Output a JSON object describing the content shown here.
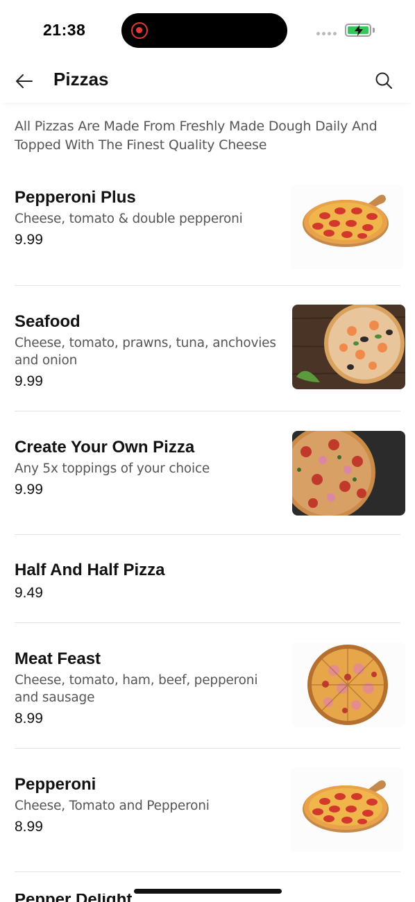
{
  "status": {
    "time": "21:38"
  },
  "header": {
    "title": "Pizzas"
  },
  "intro": "All Pizzas Are Made From Freshly Made Dough Daily And Topped With The Finest Quality Cheese",
  "items": [
    {
      "name": "Pepperoni Plus",
      "description": "Cheese, tomato & double pepperoni",
      "price": "9.99",
      "image": "pepperoni-pizza-on-board"
    },
    {
      "name": "Seafood",
      "description": "Cheese, tomato, prawns, tuna, anchovies and onion",
      "price": "9.99",
      "image": "seafood-pizza-on-wood"
    },
    {
      "name": "Create Your Own Pizza",
      "description": "Any 5x toppings of your choice",
      "price": "9.99",
      "image": "mixed-topping-pizza-on-dark"
    },
    {
      "name": "Half And Half Pizza",
      "description": "",
      "price": "9.49",
      "image": ""
    },
    {
      "name": "Meat Feast",
      "description": "Cheese, tomato, ham, beef, pepperoni and sausage",
      "price": "8.99",
      "image": "meat-feast-pizza"
    },
    {
      "name": "Pepperoni",
      "description": "Cheese, Tomato and Pepperoni",
      "price": "8.99",
      "image": "pepperoni-pizza-on-board"
    }
  ],
  "next_item_partial": "Pepper Delight",
  "colors": {
    "accent": "#e53935",
    "battery": "#34c759",
    "divider": "#e2e2e2"
  }
}
